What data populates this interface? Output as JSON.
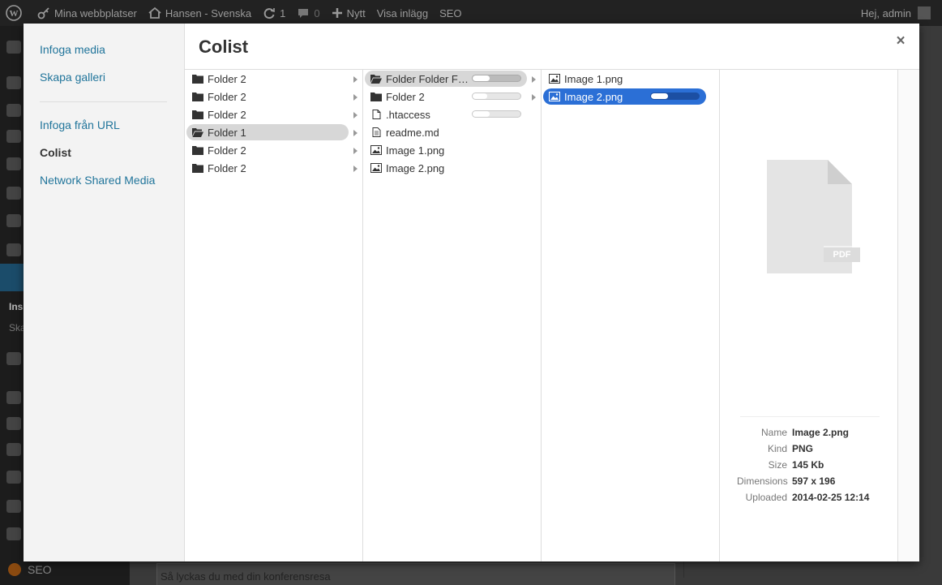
{
  "adminbar": {
    "sites": "Mina webbplatser",
    "site": "Hansen - Svenska",
    "updates": "1",
    "comments": "0",
    "new": "Nytt",
    "view": "Visa inlägg",
    "seo": "SEO",
    "greeting": "Hej, admin"
  },
  "wpmenu": {
    "sub1": "Ins",
    "sub2": "Ska",
    "seo": "SEO"
  },
  "bgpage": {
    "field_value": "Så lyckas du med din konferensresa"
  },
  "modal": {
    "title": "Colist",
    "close": "×",
    "nav": [
      {
        "label": "Infoga media"
      },
      {
        "label": "Skapa galleri"
      },
      {
        "label": "Infoga från URL"
      },
      {
        "label": "Colist"
      },
      {
        "label": "Network Shared Media"
      }
    ]
  },
  "columns": {
    "c1": [
      {
        "label": "Folder 2",
        "icon": "folder-icon"
      },
      {
        "label": "Folder 2",
        "icon": "folder-icon"
      },
      {
        "label": "Folder 2",
        "icon": "folder-icon"
      },
      {
        "label": "Folder 1",
        "icon": "folder-open-icon"
      },
      {
        "label": "Folder 2",
        "icon": "folder-icon"
      },
      {
        "label": "Folder 2",
        "icon": "folder-icon"
      }
    ],
    "c2": [
      {
        "label": "Folder Folder Folder",
        "icon": "folder-open-icon",
        "progress": 0.35
      },
      {
        "label": "Folder 2",
        "icon": "folder-icon",
        "progress": 0.3
      },
      {
        "label": ".htaccess",
        "icon": "file-icon",
        "progress": 0.35
      },
      {
        "label": "readme.md",
        "icon": "text-file-icon"
      },
      {
        "label": "Image 1.png",
        "icon": "image-icon"
      },
      {
        "label": "Image 2.png",
        "icon": "image-icon"
      }
    ],
    "c3": [
      {
        "label": "Image 1.png",
        "icon": "image-icon"
      },
      {
        "label": "Image 2.png",
        "icon": "image-icon",
        "progress": 0.35
      }
    ]
  },
  "preview": {
    "badge": "PDF",
    "meta": [
      {
        "key": "Name",
        "value": "Image 2.png"
      },
      {
        "key": "Kind",
        "value": "PNG"
      },
      {
        "key": "Size",
        "value": "145 Kb"
      },
      {
        "key": "Dimensions",
        "value": "597 x 196"
      },
      {
        "key": "Uploaded",
        "value": "2014-02-25 12:14"
      }
    ]
  },
  "colors": {
    "accent": "#2b6fd6",
    "link": "#21759b",
    "selection_gray": "#d7d7d7"
  }
}
